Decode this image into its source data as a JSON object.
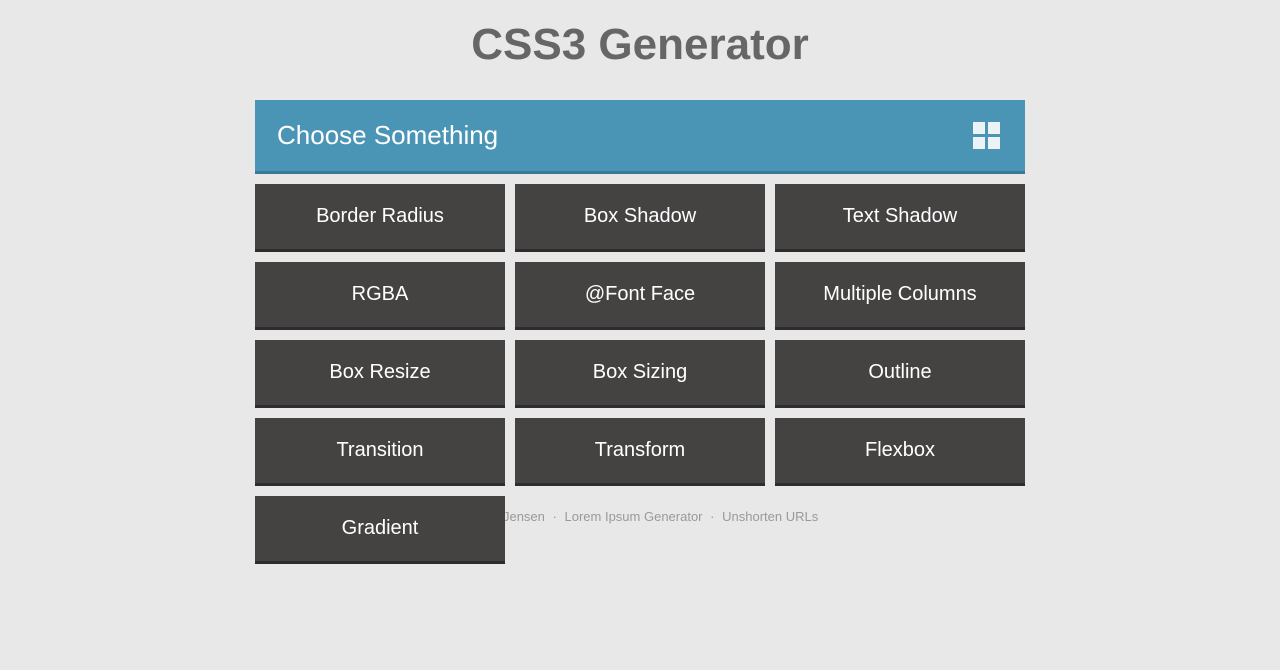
{
  "title": "CSS3 Generator",
  "header": {
    "prompt": "Choose Something"
  },
  "options": [
    "Border Radius",
    "Box Shadow",
    "Text Shadow",
    "RGBA",
    "@Font Face",
    "Multiple Columns",
    "Box Resize",
    "Box Sizing",
    "Outline",
    "Transition",
    "Transform",
    "Flexbox",
    "Gradient"
  ],
  "footer": {
    "author": "Randy Jensen",
    "link1": "Lorem Ipsum Generator",
    "link2": "Unshorten URLs",
    "sep": "·"
  }
}
